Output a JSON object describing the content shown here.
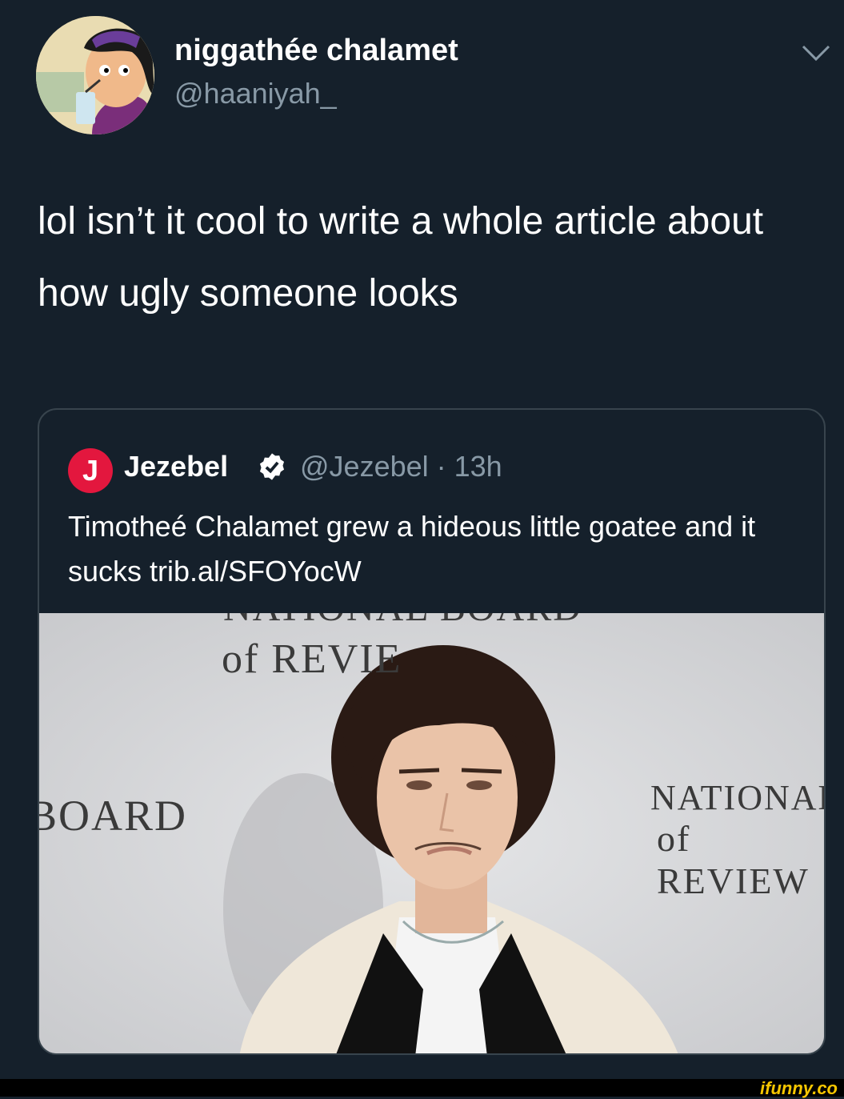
{
  "tweet": {
    "display_name": "niggathée chalamet",
    "handle": "@haaniyah_",
    "text": "lol isn’t it cool to write a whole article about how ugly someone looks"
  },
  "quoted_tweet": {
    "name": "Jezebel",
    "logo_letter": "J",
    "meta": "@Jezebel · 13h",
    "text": "Timotheé Chalamet grew a hideous little goatee and it sucks trib.al/SFOYocW",
    "image_backdrop": {
      "top_text_1": "NATIONAL BOARD",
      "top_text_2": "of REVIE",
      "left_text": "BOARD",
      "right_text_1": "NATIONAL",
      "right_text_2": "of REVIEW"
    }
  },
  "watermark": "ifunny.co",
  "colors": {
    "background": "#15202b",
    "secondary_text": "#8899a6",
    "border": "#38444d",
    "jezebel_red": "#e3173e",
    "verified": "#ffffff"
  }
}
